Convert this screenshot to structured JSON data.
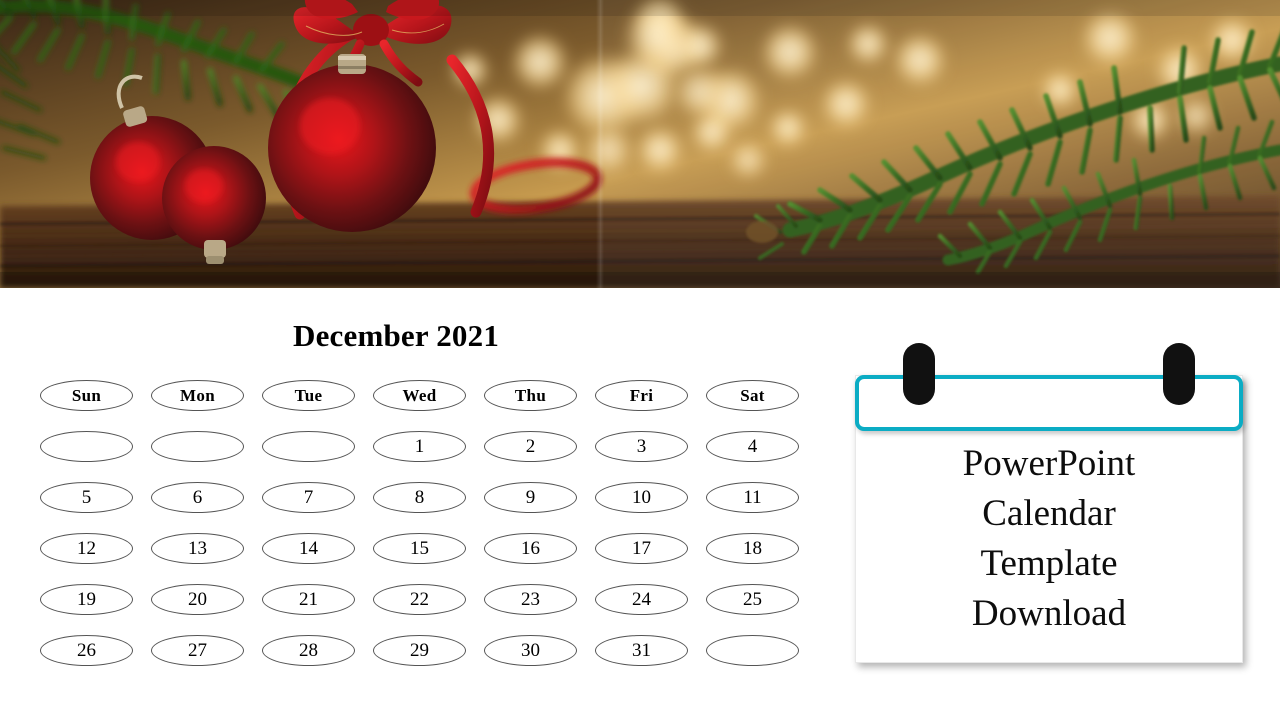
{
  "slide": {
    "background_color": "#ffffff",
    "accent_color": "#0bacc4"
  },
  "hero_image": {
    "name": "christmas-decoration-photo",
    "description": "Red matte Christmas baubles with red satin bow and ribbon on rustic wood, warm golden bokeh lights, green pine fir branches",
    "elements": [
      "red-bauble-large",
      "red-bauble-medium",
      "red-bauble-small",
      "red-ribbon-bow",
      "pine-branch-left",
      "pine-branch-right",
      "bokeh-lights",
      "wooden-table"
    ]
  },
  "calendar": {
    "title": "December 2021",
    "weekday_headers": [
      "Sun",
      "Mon",
      "Tue",
      "Wed",
      "Thu",
      "Fri",
      "Sat"
    ],
    "weeks": [
      [
        "",
        "",
        "",
        "1",
        "2",
        "3",
        "4"
      ],
      [
        "5",
        "6",
        "7",
        "8",
        "9",
        "10",
        "11"
      ],
      [
        "12",
        "13",
        "14",
        "15",
        "16",
        "17",
        "18"
      ],
      [
        "19",
        "20",
        "21",
        "22",
        "23",
        "24",
        "25"
      ],
      [
        "26",
        "27",
        "28",
        "29",
        "30",
        "31",
        ""
      ]
    ]
  },
  "note_card": {
    "accent_color": "#0bacc4",
    "ring_color": "#111111",
    "lines": [
      "PowerPoint",
      "Calendar",
      "Template",
      "Download"
    ]
  }
}
